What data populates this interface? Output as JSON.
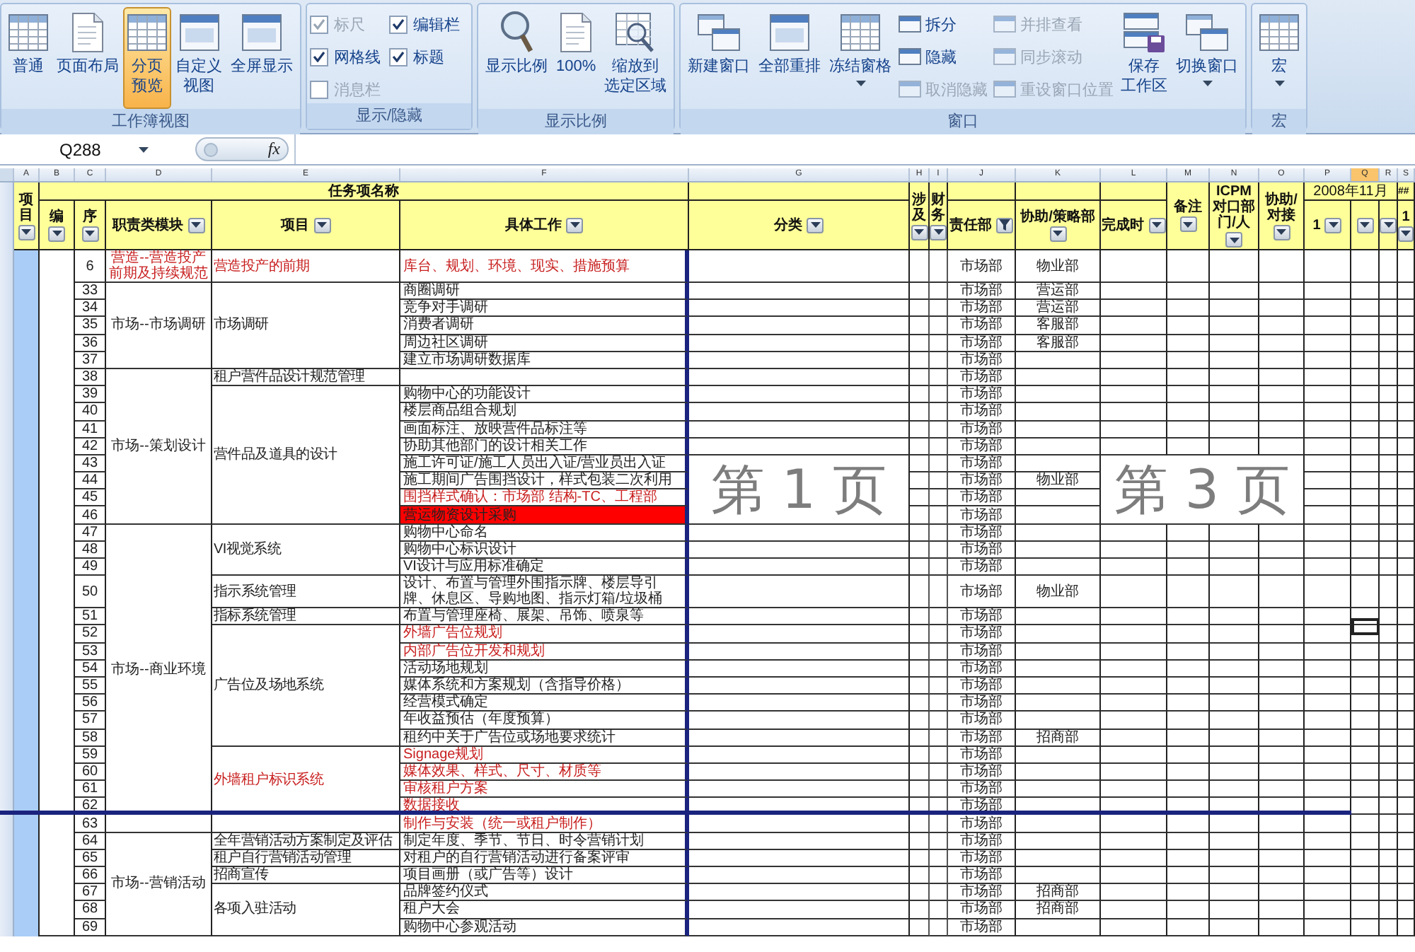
{
  "ribbon": {
    "groups": [
      {
        "label": "工作簿视图",
        "items": [
          {
            "kind": "large",
            "label": [
              "普通"
            ],
            "selected": false,
            "disabled": false,
            "dropdown": false
          },
          {
            "kind": "large",
            "label": [
              "页面布局"
            ],
            "selected": false,
            "disabled": false,
            "dropdown": false
          },
          {
            "kind": "large",
            "label": [
              "分页",
              "预览"
            ],
            "selected": true,
            "disabled": false,
            "dropdown": false
          },
          {
            "kind": "large",
            "label": [
              "自定义",
              "视图"
            ],
            "selected": false,
            "disabled": false,
            "dropdown": false
          },
          {
            "kind": "large",
            "label": [
              "全屏显示"
            ],
            "selected": false,
            "disabled": false,
            "dropdown": false
          }
        ]
      },
      {
        "label": "显示/隐藏",
        "items": [
          {
            "kind": "stack",
            "items": [
              {
                "kind": "check",
                "label": "标尺",
                "checked": true,
                "disabled": true
              },
              {
                "kind": "check",
                "label": "网格线",
                "checked": true,
                "disabled": false
              },
              {
                "kind": "check",
                "label": "消息栏",
                "checked": false,
                "disabled": true
              }
            ]
          },
          {
            "kind": "stack",
            "items": [
              {
                "kind": "check",
                "label": "编辑栏",
                "checked": true,
                "disabled": false
              },
              {
                "kind": "check",
                "label": "标题",
                "checked": true,
                "disabled": false
              }
            ]
          }
        ]
      },
      {
        "label": "显示比例",
        "items": [
          {
            "kind": "large",
            "label": [
              "显示比例"
            ],
            "selected": false,
            "disabled": false,
            "dropdown": false
          },
          {
            "kind": "large",
            "label": [
              "100%"
            ],
            "selected": false,
            "disabled": false,
            "dropdown": false
          },
          {
            "kind": "large",
            "label": [
              "缩放到",
              "选定区域"
            ],
            "selected": false,
            "disabled": false,
            "dropdown": false
          }
        ]
      },
      {
        "label": "窗口",
        "items": [
          {
            "kind": "large",
            "label": [
              "新建窗口"
            ],
            "selected": false,
            "disabled": false,
            "dropdown": false
          },
          {
            "kind": "large",
            "label": [
              "全部重排"
            ],
            "selected": false,
            "disabled": false,
            "dropdown": false
          },
          {
            "kind": "large",
            "label": [
              "冻结窗格"
            ],
            "selected": false,
            "disabled": false,
            "dropdown": true
          },
          {
            "kind": "stack",
            "items": [
              {
                "kind": "small",
                "label": "拆分",
                "disabled": false
              },
              {
                "kind": "small",
                "label": "隐藏",
                "disabled": false
              },
              {
                "kind": "small",
                "label": "取消隐藏",
                "disabled": true
              }
            ]
          },
          {
            "kind": "stack",
            "items": [
              {
                "kind": "small",
                "label": "并排查看",
                "disabled": true
              },
              {
                "kind": "small",
                "label": "同步滚动",
                "disabled": true
              },
              {
                "kind": "small",
                "label": "重设窗口位置",
                "disabled": true
              }
            ]
          },
          {
            "kind": "large",
            "label": [
              "保存",
              "工作区"
            ],
            "selected": false,
            "disabled": false,
            "dropdown": false
          },
          {
            "kind": "large",
            "label": [
              "切换窗口"
            ],
            "selected": false,
            "disabled": false,
            "dropdown": true
          }
        ]
      },
      {
        "label": "宏",
        "items": [
          {
            "kind": "large",
            "label": [
              "宏"
            ],
            "selected": false,
            "disabled": false,
            "dropdown": true
          }
        ]
      }
    ]
  },
  "formula_bar": {
    "name_box": "Q288",
    "function_label": "fx"
  },
  "sheet": {
    "title": "任务项名称",
    "period": "2008年11月",
    "overflow_mark": "##",
    "page_labels": [
      "第 1 页",
      "第 3 页"
    ],
    "columns": [
      {
        "letter": "A",
        "heading": "项目",
        "filtered": false,
        "selected": false
      },
      {
        "letter": "B",
        "heading": "编",
        "filtered": false,
        "selected": false
      },
      {
        "letter": "C",
        "heading": "序",
        "filtered": false,
        "selected": false
      },
      {
        "letter": "D",
        "heading": "职责类模块",
        "filtered": false,
        "selected": false
      },
      {
        "letter": "E",
        "heading": "项目",
        "filtered": false,
        "selected": false
      },
      {
        "letter": "F",
        "heading": "具体工作",
        "filtered": false,
        "selected": false
      },
      {
        "letter": "G",
        "heading": "分类",
        "filtered": false,
        "selected": false
      },
      {
        "letter": "H",
        "heading": "涉及",
        "filtered": false,
        "selected": false
      },
      {
        "letter": "I",
        "heading": "财务",
        "filtered": false,
        "selected": false
      },
      {
        "letter": "J",
        "heading": "责任部",
        "filtered": true,
        "selected": false
      },
      {
        "letter": "K",
        "heading": "协助/策略部",
        "filtered": false,
        "selected": false
      },
      {
        "letter": "L",
        "heading": "完成时",
        "filtered": false,
        "selected": false
      },
      {
        "letter": "M",
        "heading": "备注",
        "filtered": false,
        "selected": false
      },
      {
        "letter": "N",
        "heading": "ICPM对口部门/人",
        "filtered": false,
        "selected": false
      },
      {
        "letter": "O",
        "heading": "协助/对接",
        "filtered": false,
        "selected": false
      },
      {
        "letter": "P",
        "heading": "1",
        "filtered": false,
        "selected": false
      },
      {
        "letter": "Q",
        "filtered": false,
        "selected": true
      },
      {
        "letter": "R",
        "filtered": false,
        "selected": false
      },
      {
        "letter": "S",
        "heading": "1",
        "filtered": false,
        "selected": false
      }
    ],
    "sections": [
      {
        "module": "营造--营造投产前期及持续规范",
        "emphasized": true,
        "page_break_after": false,
        "projects": [
          {
            "title": "营造投产的前期",
            "emphasized": true,
            "tasks": [
              {
                "number": "6",
                "work": "库台、规划、环境、现实、措施预算",
                "emphasized": true,
                "flagged": false,
                "owner": "市场部",
                "partner": "物业部"
              }
            ]
          }
        ]
      },
      {
        "module": "市场--市场调研",
        "emphasized": false,
        "page_break_after": false,
        "projects": [
          {
            "title": "市场调研",
            "emphasized": false,
            "tasks": [
              {
                "number": "33",
                "work": "商圈调研",
                "emphasized": false,
                "flagged": false,
                "owner": "市场部",
                "partner": "营运部"
              },
              {
                "number": "34",
                "work": "竞争对手调研",
                "emphasized": false,
                "flagged": false,
                "owner": "市场部",
                "partner": "营运部"
              },
              {
                "number": "35",
                "work": "消费者调研",
                "emphasized": false,
                "flagged": false,
                "owner": "市场部",
                "partner": "客服部"
              },
              {
                "number": "36",
                "work": "周边社区调研",
                "emphasized": false,
                "flagged": false,
                "owner": "市场部",
                "partner": "客服部"
              },
              {
                "number": "37",
                "work": "建立市场调研数据库",
                "emphasized": false,
                "flagged": false,
                "owner": "市场部"
              }
            ]
          }
        ]
      },
      {
        "module": "市场--策划设计",
        "emphasized": false,
        "page_break_after": false,
        "projects": [
          {
            "title": "租户营件品设计规范管理",
            "emphasized": false,
            "tasks": [
              {
                "number": "38",
                "flagged": false,
                "owner": "市场部"
              }
            ]
          },
          {
            "title": "营件品及道具的设计",
            "emphasized": false,
            "tasks": [
              {
                "number": "39",
                "work": "购物中心的功能设计",
                "emphasized": false,
                "flagged": false,
                "owner": "市场部"
              },
              {
                "number": "40",
                "work": "楼层商品组合规划",
                "emphasized": false,
                "flagged": false,
                "owner": "市场部"
              },
              {
                "number": "41",
                "work": "画面标注、放映营件品标注等",
                "emphasized": false,
                "flagged": false,
                "owner": "市场部"
              },
              {
                "number": "42",
                "work": "协助其他部门的设计相关工作",
                "emphasized": false,
                "flagged": false,
                "owner": "市场部"
              },
              {
                "number": "43",
                "work": "施工许可证/施工人员出入证/营业员出入证",
                "emphasized": false,
                "flagged": false,
                "owner": "市场部"
              },
              {
                "number": "44",
                "work": "施工期间广告围挡设计，样式包装二次利用",
                "emphasized": false,
                "flagged": false,
                "owner": "市场部",
                "partner": "物业部"
              },
              {
                "number": "45",
                "work": "围挡样式确认：市场部 结构-TC、工程部",
                "emphasized": true,
                "flagged": false,
                "owner": "市场部"
              },
              {
                "number": "46",
                "work": "营运物资设计采购",
                "emphasized": false,
                "flagged": true,
                "owner": "市场部"
              }
            ]
          }
        ]
      },
      {
        "module": "市场--商业环境",
        "emphasized": false,
        "page_break_after": true,
        "projects": [
          {
            "title": "VI视觉系统",
            "emphasized": false,
            "tasks": [
              {
                "number": "47",
                "work": "购物中心命名",
                "emphasized": false,
                "flagged": false,
                "owner": "市场部"
              },
              {
                "number": "48",
                "work": "购物中心标识设计",
                "emphasized": false,
                "flagged": false,
                "owner": "市场部"
              },
              {
                "number": "49",
                "work": "VI设计与应用标准确定",
                "emphasized": false,
                "flagged": false,
                "owner": "市场部"
              }
            ]
          },
          {
            "title": "指示系统管理",
            "emphasized": false,
            "tasks": [
              {
                "number": "50",
                "work": "设计、布置与管理外围指示牌、楼层导引牌、休息区、导购地图、指示灯箱/垃圾桶",
                "emphasized": false,
                "flagged": false,
                "owner": "市场部",
                "partner": "物业部"
              }
            ]
          },
          {
            "title": "指标系统管理",
            "emphasized": false,
            "tasks": [
              {
                "number": "51",
                "work": "布置与管理座椅、展架、吊饰、喷泉等",
                "emphasized": false,
                "flagged": false,
                "owner": "市场部"
              }
            ]
          },
          {
            "title": "广告位及场地系统",
            "emphasized": false,
            "tasks": [
              {
                "number": "52",
                "work": "外墙广告位规划",
                "emphasized": true,
                "flagged": false,
                "owner": "市场部"
              },
              {
                "number": "53",
                "work": "内部广告位开发和规划",
                "emphasized": true,
                "flagged": false,
                "owner": "市场部"
              },
              {
                "number": "54",
                "work": "活动场地规划",
                "emphasized": false,
                "flagged": false,
                "owner": "市场部"
              },
              {
                "number": "55",
                "work": "媒体系统和方案规划（含指导价格）",
                "emphasized": false,
                "flagged": false,
                "owner": "市场部"
              },
              {
                "number": "56",
                "work": "经营模式确定",
                "emphasized": false,
                "flagged": false,
                "owner": "市场部"
              },
              {
                "number": "57",
                "work": "年收益预估（年度预算）",
                "emphasized": false,
                "flagged": false,
                "owner": "市场部"
              },
              {
                "number": "58",
                "work": "租约中关于广告位或场地要求统计",
                "emphasized": false,
                "flagged": false,
                "owner": "市场部",
                "partner": "招商部"
              }
            ]
          },
          {
            "title": "外墙租户标识系统",
            "emphasized": true,
            "tasks": [
              {
                "number": "59",
                "work": "Signage规划",
                "emphasized": true,
                "flagged": false,
                "owner": "市场部"
              },
              {
                "number": "60",
                "work": "媒体效果、样式、尺寸、材质等",
                "emphasized": true,
                "flagged": false,
                "owner": "市场部"
              },
              {
                "number": "61",
                "work": "审核租户方案",
                "emphasized": true,
                "flagged": false,
                "owner": "市场部"
              },
              {
                "number": "62",
                "work": "数据接收",
                "emphasized": true,
                "flagged": false,
                "owner": "市场部"
              }
            ]
          }
        ]
      },
      {
        "page_break_after": false,
        "projects": [
          {
            "tasks": [
              {
                "number": "63",
                "work": "制作与安装（统一或租户制作）",
                "emphasized": true,
                "flagged": false,
                "owner": "市场部"
              }
            ]
          }
        ]
      },
      {
        "module": "市场--营销活动",
        "emphasized": false,
        "page_break_after": false,
        "projects": [
          {
            "title": "全年营销活动方案制定及评估",
            "emphasized": false,
            "tasks": [
              {
                "number": "64",
                "work": "制定年度、季节、节日、时令营销计划",
                "emphasized": false,
                "flagged": false,
                "owner": "市场部"
              }
            ]
          },
          {
            "title": "租户自行营销活动管理",
            "emphasized": false,
            "tasks": [
              {
                "number": "65",
                "work": "对租户的自行营销活动进行备案评审",
                "emphasized": false,
                "flagged": false,
                "owner": "市场部"
              }
            ]
          },
          {
            "title": "招商宣传",
            "emphasized": false,
            "tasks": [
              {
                "number": "66",
                "work": "项目画册（或广告等）设计",
                "emphasized": false,
                "flagged": false,
                "owner": "市场部"
              }
            ]
          },
          {
            "title": "各项入驻活动",
            "emphasized": false,
            "tasks": [
              {
                "number": "67",
                "work": "品牌签约仪式",
                "emphasized": false,
                "flagged": false,
                "owner": "市场部",
                "partner": "招商部"
              },
              {
                "number": "68",
                "work": "租户大会",
                "emphasized": false,
                "flagged": false,
                "owner": "市场部",
                "partner": "招商部"
              },
              {
                "number": "69",
                "work": "购物中心参观活动",
                "emphasized": false,
                "flagged": false,
                "owner": "市场部"
              }
            ]
          }
        ]
      }
    ]
  }
}
